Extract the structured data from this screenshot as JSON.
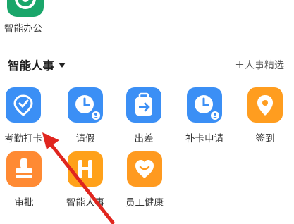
{
  "top_app": {
    "label": "智能办公",
    "icon": "smart-office-icon",
    "color": "#1aa66a"
  },
  "section": {
    "title": "智能人事",
    "select_link": "＋人事精选"
  },
  "apps": [
    {
      "label": "考勤打卡",
      "icon": "location-check-icon",
      "color": "#3b8ff5"
    },
    {
      "label": "请假",
      "icon": "clock-icon",
      "color": "#3b8ff5"
    },
    {
      "label": "出差",
      "icon": "suitcase-plane-icon",
      "color": "#3b8ff5"
    },
    {
      "label": "补卡申请",
      "icon": "clock-icon",
      "color": "#3b8ff5"
    },
    {
      "label": "签到",
      "icon": "location-pin-icon",
      "color": "#ff9d1f"
    },
    {
      "label": "审批",
      "icon": "stamp-icon",
      "color": "#ff8a33"
    },
    {
      "label": "智能人事",
      "icon": "h-badge-icon",
      "color": "#ffa11a"
    },
    {
      "label": "员工健康",
      "icon": "heart-icon",
      "color": "#ff9a1f"
    }
  ],
  "annotation_color": "#e0261f"
}
